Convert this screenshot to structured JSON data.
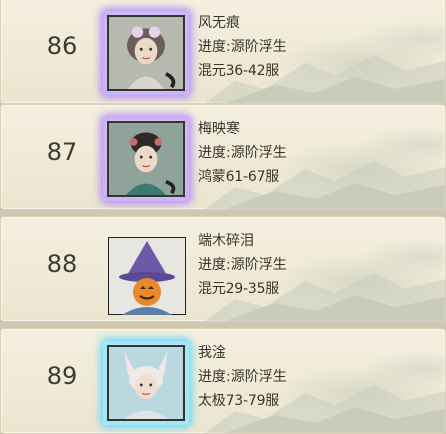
{
  "rows": [
    {
      "rank": "86",
      "name": "风无痕",
      "stage": "进度:源阶浮生",
      "server": "混元36-42服",
      "frame": "purple"
    },
    {
      "rank": "87",
      "name": "梅映寒",
      "stage": "进度:源阶浮生",
      "server": "鸿蒙61-67服",
      "frame": "purple"
    },
    {
      "rank": "88",
      "name": "端木碎泪",
      "stage": "进度:源阶浮生",
      "server": "混元29-35服",
      "frame": "plain"
    },
    {
      "rank": "89",
      "name": "我淦",
      "stage": "进度:源阶浮生",
      "server": "太极73-79服",
      "frame": "cyan"
    }
  ],
  "colors": {
    "row_background": "#efe9d6",
    "text": "#3a352b",
    "frame_purple": "#c9b3ff",
    "frame_cyan": "#9fe9ff"
  }
}
